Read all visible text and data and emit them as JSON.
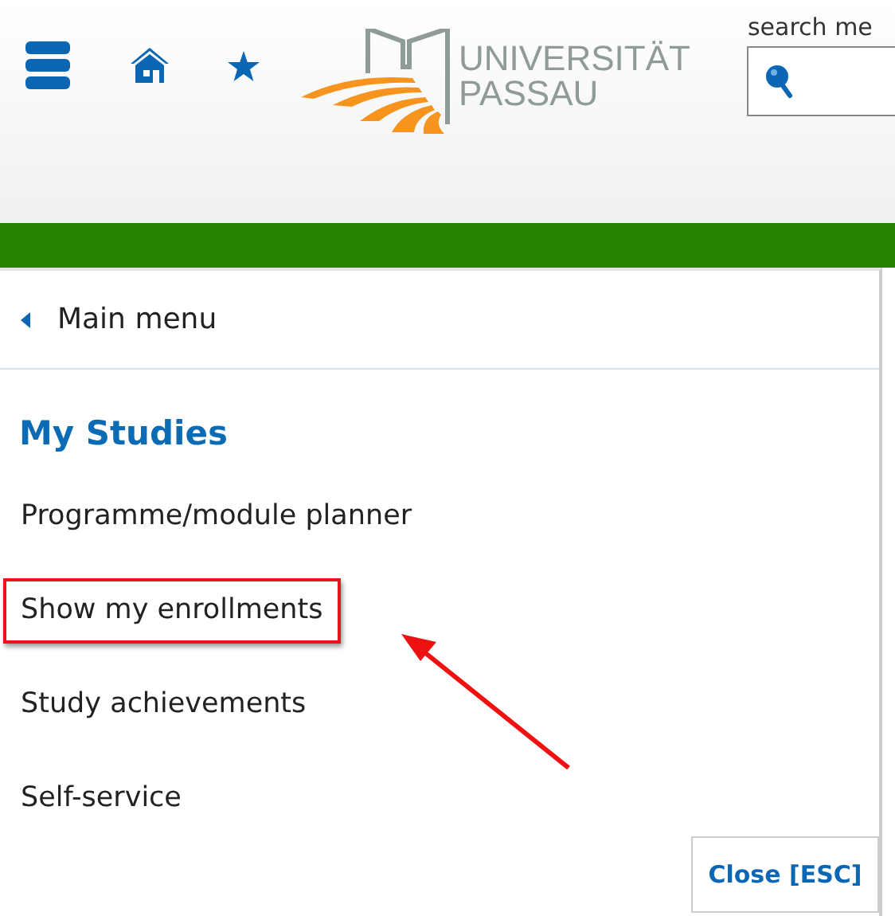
{
  "header": {
    "logo": {
      "line_1": "UNIVERSITÄT",
      "line_2": "PASSAU"
    },
    "search": {
      "label": "search me"
    }
  },
  "menu": {
    "back": "Main menu",
    "title": "My Studies",
    "items": [
      {
        "label": "Programme/module planner",
        "highlighted": false
      },
      {
        "label": "Show my enrollments",
        "highlighted": true
      },
      {
        "label": "Study achievements",
        "highlighted": false
      },
      {
        "label": "Self-service",
        "highlighted": false
      }
    ],
    "close": "Close [ESC]"
  }
}
